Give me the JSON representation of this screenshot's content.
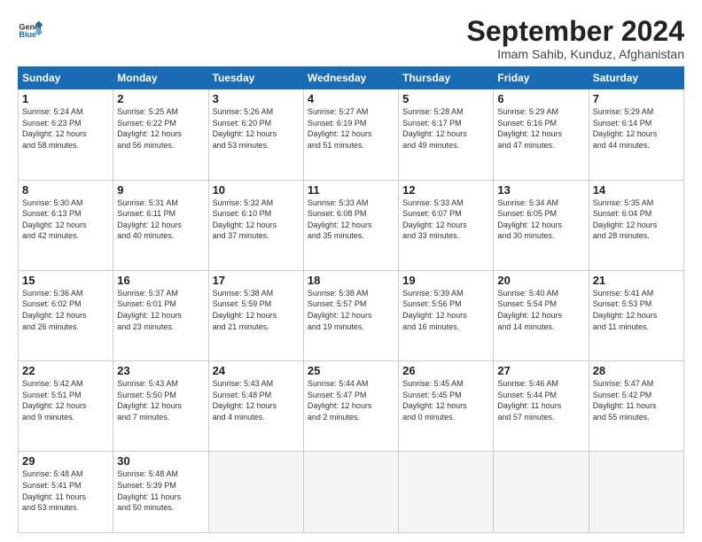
{
  "logo": {
    "line1": "General",
    "line2": "Blue"
  },
  "title": "September 2024",
  "subtitle": "Imam Sahib, Kunduz, Afghanistan",
  "headers": [
    "Sunday",
    "Monday",
    "Tuesday",
    "Wednesday",
    "Thursday",
    "Friday",
    "Saturday"
  ],
  "weeks": [
    [
      {
        "day": "1",
        "sunrise": "5:24 AM",
        "sunset": "6:23 PM",
        "daylight": "12 hours and 58 minutes."
      },
      {
        "day": "2",
        "sunrise": "5:25 AM",
        "sunset": "6:22 PM",
        "daylight": "12 hours and 56 minutes."
      },
      {
        "day": "3",
        "sunrise": "5:26 AM",
        "sunset": "6:20 PM",
        "daylight": "12 hours and 53 minutes."
      },
      {
        "day": "4",
        "sunrise": "5:27 AM",
        "sunset": "6:19 PM",
        "daylight": "12 hours and 51 minutes."
      },
      {
        "day": "5",
        "sunrise": "5:28 AM",
        "sunset": "6:17 PM",
        "daylight": "12 hours and 49 minutes."
      },
      {
        "day": "6",
        "sunrise": "5:29 AM",
        "sunset": "6:16 PM",
        "daylight": "12 hours and 47 minutes."
      },
      {
        "day": "7",
        "sunrise": "5:29 AM",
        "sunset": "6:14 PM",
        "daylight": "12 hours and 44 minutes."
      }
    ],
    [
      {
        "day": "8",
        "sunrise": "5:30 AM",
        "sunset": "6:13 PM",
        "daylight": "12 hours and 42 minutes."
      },
      {
        "day": "9",
        "sunrise": "5:31 AM",
        "sunset": "6:11 PM",
        "daylight": "12 hours and 40 minutes."
      },
      {
        "day": "10",
        "sunrise": "5:32 AM",
        "sunset": "6:10 PM",
        "daylight": "12 hours and 37 minutes."
      },
      {
        "day": "11",
        "sunrise": "5:33 AM",
        "sunset": "6:08 PM",
        "daylight": "12 hours and 35 minutes."
      },
      {
        "day": "12",
        "sunrise": "5:33 AM",
        "sunset": "6:07 PM",
        "daylight": "12 hours and 33 minutes."
      },
      {
        "day": "13",
        "sunrise": "5:34 AM",
        "sunset": "6:05 PM",
        "daylight": "12 hours and 30 minutes."
      },
      {
        "day": "14",
        "sunrise": "5:35 AM",
        "sunset": "6:04 PM",
        "daylight": "12 hours and 28 minutes."
      }
    ],
    [
      {
        "day": "15",
        "sunrise": "5:36 AM",
        "sunset": "6:02 PM",
        "daylight": "12 hours and 26 minutes."
      },
      {
        "day": "16",
        "sunrise": "5:37 AM",
        "sunset": "6:01 PM",
        "daylight": "12 hours and 23 minutes."
      },
      {
        "day": "17",
        "sunrise": "5:38 AM",
        "sunset": "5:59 PM",
        "daylight": "12 hours and 21 minutes."
      },
      {
        "day": "18",
        "sunrise": "5:38 AM",
        "sunset": "5:57 PM",
        "daylight": "12 hours and 19 minutes."
      },
      {
        "day": "19",
        "sunrise": "5:39 AM",
        "sunset": "5:56 PM",
        "daylight": "12 hours and 16 minutes."
      },
      {
        "day": "20",
        "sunrise": "5:40 AM",
        "sunset": "5:54 PM",
        "daylight": "12 hours and 14 minutes."
      },
      {
        "day": "21",
        "sunrise": "5:41 AM",
        "sunset": "5:53 PM",
        "daylight": "12 hours and 11 minutes."
      }
    ],
    [
      {
        "day": "22",
        "sunrise": "5:42 AM",
        "sunset": "5:51 PM",
        "daylight": "12 hours and 9 minutes."
      },
      {
        "day": "23",
        "sunrise": "5:43 AM",
        "sunset": "5:50 PM",
        "daylight": "12 hours and 7 minutes."
      },
      {
        "day": "24",
        "sunrise": "5:43 AM",
        "sunset": "5:48 PM",
        "daylight": "12 hours and 4 minutes."
      },
      {
        "day": "25",
        "sunrise": "5:44 AM",
        "sunset": "5:47 PM",
        "daylight": "12 hours and 2 minutes."
      },
      {
        "day": "26",
        "sunrise": "5:45 AM",
        "sunset": "5:45 PM",
        "daylight": "12 hours and 0 minutes."
      },
      {
        "day": "27",
        "sunrise": "5:46 AM",
        "sunset": "5:44 PM",
        "daylight": "11 hours and 57 minutes."
      },
      {
        "day": "28",
        "sunrise": "5:47 AM",
        "sunset": "5:42 PM",
        "daylight": "11 hours and 55 minutes."
      }
    ],
    [
      {
        "day": "29",
        "sunrise": "5:48 AM",
        "sunset": "5:41 PM",
        "daylight": "11 hours and 53 minutes."
      },
      {
        "day": "30",
        "sunrise": "5:48 AM",
        "sunset": "5:39 PM",
        "daylight": "11 hours and 50 minutes."
      },
      null,
      null,
      null,
      null,
      null
    ]
  ]
}
